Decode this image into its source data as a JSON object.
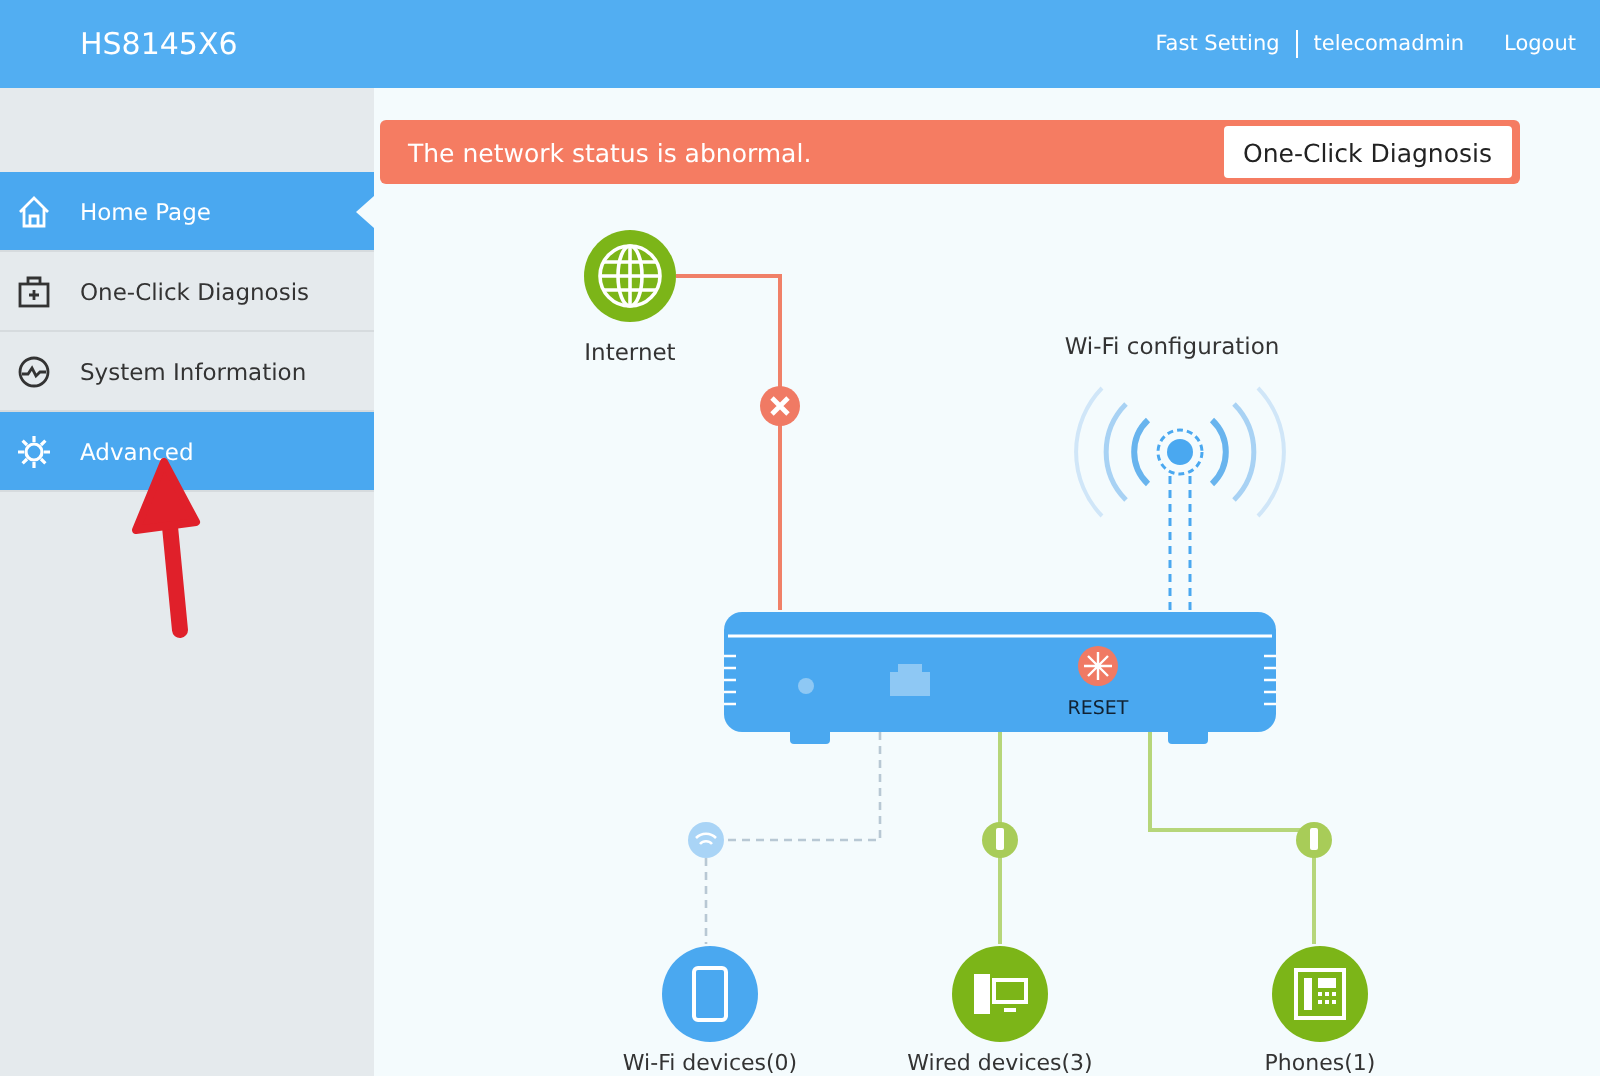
{
  "header": {
    "title": "HS8145X6",
    "links": [
      "Fast Setting",
      "telecomadmin",
      "Logout"
    ]
  },
  "sidebar": {
    "items": [
      {
        "label": "Home Page",
        "selected": true,
        "highlighted": true
      },
      {
        "label": "One-Click Diagnosis",
        "selected": false,
        "highlighted": false
      },
      {
        "label": "System Information",
        "selected": false,
        "highlighted": false
      },
      {
        "label": "Advanced",
        "selected": false,
        "highlighted": true
      }
    ]
  },
  "alert": {
    "message": "The network status is abnormal.",
    "button": "One-Click Diagnosis"
  },
  "topology": {
    "internet": {
      "label": "Internet",
      "connected": false
    },
    "wifi": {
      "label": "Wi-Fi configuration"
    },
    "router": {
      "reset_label": "RESET"
    },
    "devices": [
      {
        "kind": "wifi",
        "label": "Wi-Fi devices(0)"
      },
      {
        "kind": "wired",
        "label": "Wired devices(3)"
      },
      {
        "kind": "phone",
        "label": "Phones(1)"
      }
    ]
  }
}
